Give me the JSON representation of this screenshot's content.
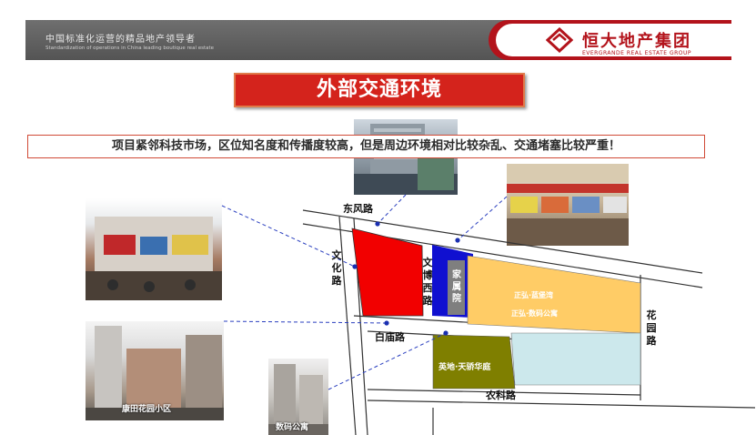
{
  "header": {
    "slogan_cn": "中国标准化运营的精品地产领导者",
    "slogan_en": "Standardization of operations in China leading boutique real estate",
    "brand_cn": "恒大地产集团",
    "brand_en": "EVERGRANDE REAL ESTATE GROUP"
  },
  "title": "外部交通环境",
  "summary": "项目紧邻科技市场，区位知名度和传播度较高，但是周边环境相对比较杂乱、交通堵塞比较严重！",
  "photos": {
    "bottom_left_caption": "康田花园小区",
    "bottom_caption": "数码公寓"
  },
  "map": {
    "roads": {
      "dongfeng": "东风路",
      "wenhua": "文化路",
      "wenbo_west": "文博西路",
      "baimiao": "白庙路",
      "nongke": "农科路",
      "huayuan": "花园路"
    },
    "blocks": {
      "family_courtyard": "家属院",
      "zhenghong_1": "正弘·蓝堡湾",
      "zhenghong_2": "正弘·数码公寓",
      "yingdi": "英地·天骄华庭"
    }
  },
  "colors": {
    "brand_red": "#b3131b",
    "title_red": "#d4231c",
    "project_red": "#f20000",
    "blue_block": "#1010d0",
    "gray_block": "#7f7f7f",
    "yellow_block": "#ffcc66",
    "cyan_block": "#cce8ec",
    "olive_block": "#7f7f00",
    "leader_line": "#2a3fbf"
  }
}
